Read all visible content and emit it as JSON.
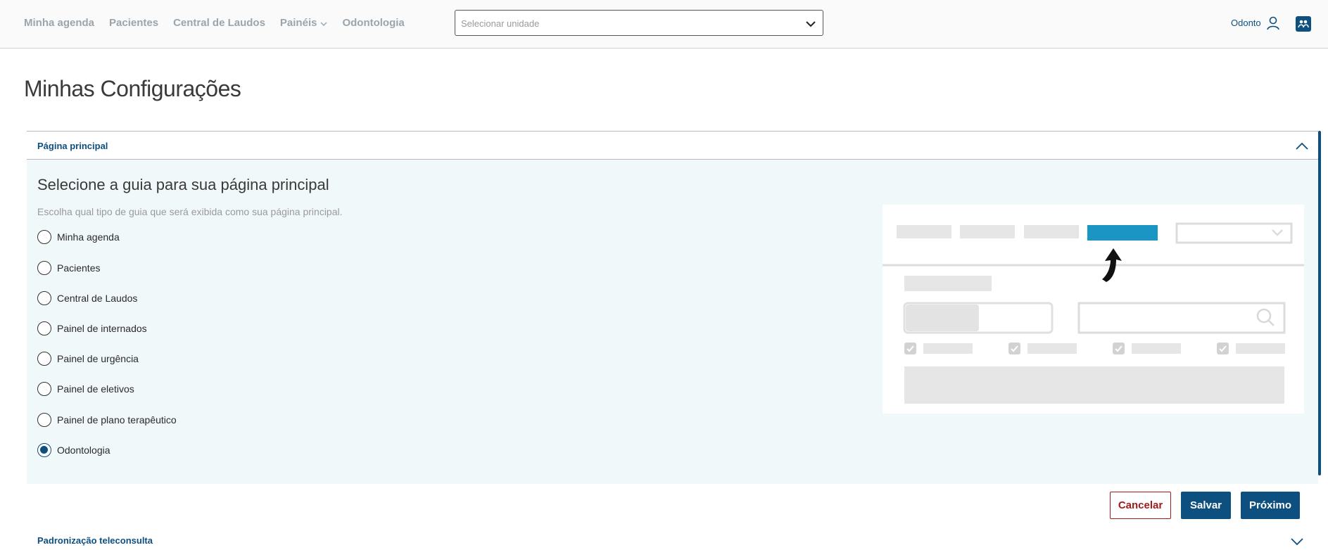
{
  "nav": {
    "items": [
      "Minha agenda",
      "Pacientes",
      "Central de Laudos",
      "Painéis",
      "Odontologia"
    ]
  },
  "unit_select": {
    "placeholder": "Selecionar unidade"
  },
  "user": {
    "name": "Odonto"
  },
  "page": {
    "title": "Minhas Configurações"
  },
  "section_main": {
    "label": "Página principal",
    "heading": "Selecione a guia para sua página principal",
    "description": "Escolha qual tipo de guia que será exibida como sua página principal.",
    "options": [
      "Minha agenda",
      "Pacientes",
      "Central de Laudos",
      "Painel de internados",
      "Painel de urgência",
      "Painel de eletivos",
      "Painel de plano terapêutico",
      "Odontologia"
    ],
    "selected": "Odontologia"
  },
  "buttons": {
    "cancel": "Cancelar",
    "save": "Salvar",
    "next": "Próximo"
  },
  "section_teleconsulta": {
    "label": "Padronização teleconsulta"
  },
  "colors": {
    "primary": "#0d4f7f",
    "cancel": "#a01c1c",
    "accent": "#1a95c4"
  },
  "icons": [
    "chevron-down-icon",
    "chevron-up-icon",
    "user-icon",
    "app-icon",
    "search-icon",
    "arrow-up-icon"
  ]
}
